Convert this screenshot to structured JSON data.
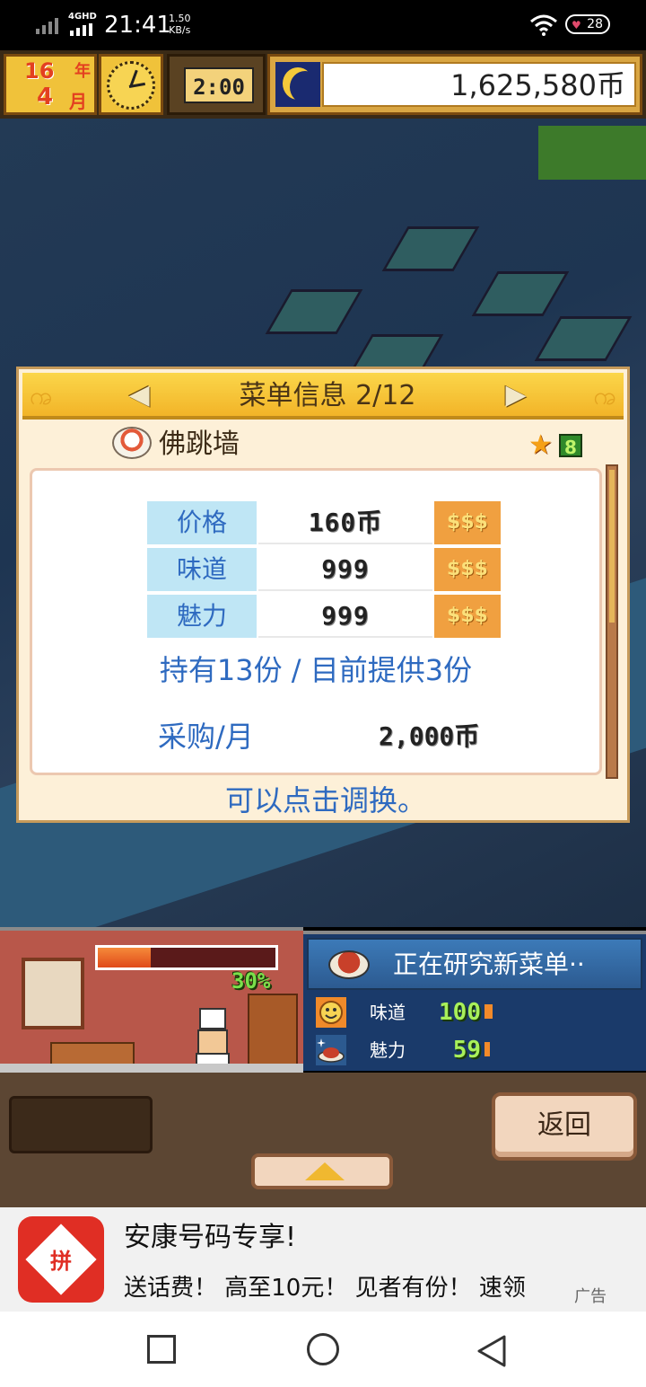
{
  "status_bar": {
    "network": "4GHD",
    "time": "21:41",
    "speed": "1.50",
    "speed_unit": "KB/s",
    "battery": "28"
  },
  "hud": {
    "year": "16",
    "year_char": "年",
    "month": "4",
    "month_char": "月",
    "clock_time": "2:00",
    "money": "1,625,580币"
  },
  "dialog": {
    "title": "菜单信息 2/12",
    "dish_name": "佛跳墙",
    "star_level": "8",
    "stats": [
      {
        "label": "价格",
        "value": "160币",
        "coins": "$$$"
      },
      {
        "label": "味道",
        "value": "999",
        "coins": "$$$"
      },
      {
        "label": "魅力",
        "value": "999",
        "coins": "$$$"
      }
    ],
    "stock": "持有13份 / 目前提供3份",
    "purchase_label": "采购/月",
    "purchase_value": "2,000币",
    "hint": "可以点击调换。"
  },
  "kitchen": {
    "progress_percent": 30,
    "progress_label": "30%"
  },
  "research": {
    "title": "正在研究新菜单··",
    "stats": [
      {
        "label": "味道",
        "value": "100",
        "level": 0.05
      },
      {
        "label": "魅力",
        "value": "59",
        "level": 0.02
      }
    ]
  },
  "controls": {
    "back_label": "返回"
  },
  "ad": {
    "title": "安康号码专享!",
    "text": "送话费！ 高至10元！ 见者有份！ 速领",
    "tag": "广告",
    "logo_glyph": "拼"
  },
  "colors": {
    "accent_blue": "#2e6ac0",
    "gold": "#f2b428",
    "progress": "#e04a1a"
  }
}
